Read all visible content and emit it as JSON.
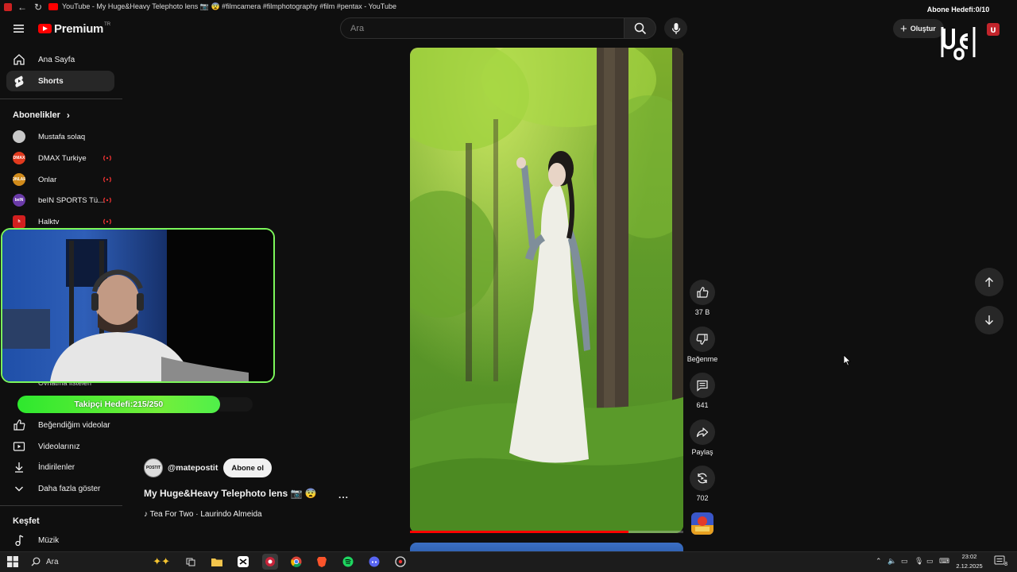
{
  "window": {
    "title": "YouTube - My Huge&Heavy Telephoto lens 📷 😨 #filmcamera #filmphotography #film #pentax - YouTube"
  },
  "header": {
    "brand": "Premium",
    "brand_sup": "TR",
    "search_placeholder": "Ara",
    "create_label": "Oluştur"
  },
  "overlay": {
    "subscriber_goal": "Abone Hedefi:0/10",
    "follower_goal": "Takipçi Hedefi:215/250",
    "follower_progress": 0.86,
    "channel_logo": "UGO"
  },
  "sidebar": {
    "nav": [
      {
        "label": "Ana Sayfa",
        "icon": "home-icon"
      },
      {
        "label": "Shorts",
        "icon": "shorts-icon"
      }
    ],
    "subscriptions_label": "Abonelikler",
    "subscriptions": [
      {
        "label": "Mustafa solaq",
        "avatar": "",
        "live": false,
        "color": "#c8c8c8"
      },
      {
        "label": "DMAX Turkiye",
        "avatar": "DMAX",
        "live": true,
        "color": "#e23a1e"
      },
      {
        "label": "Onlar",
        "avatar": "ONLAR",
        "live": true,
        "color": "#d08a1a"
      },
      {
        "label": "beIN SPORTS Tü...",
        "avatar": "beIN",
        "live": true,
        "color": "#6a3aa8"
      },
      {
        "label": "Halktv",
        "avatar": "h",
        "live": true,
        "color": "#d21f1f"
      }
    ],
    "hidden_item": "Oynatma listeleri",
    "you_items": [
      {
        "label": "Beğendiğim videolar",
        "icon": "like-icon"
      },
      {
        "label": "Videolarınız",
        "icon": "video-icon"
      },
      {
        "label": "İndirilenler",
        "icon": "download-icon"
      },
      {
        "label": "Daha fazla göster",
        "icon": "chevron-down-icon"
      }
    ],
    "explore_label": "Keşfet",
    "explore_items": [
      {
        "label": "Müzik",
        "icon": "music-icon"
      }
    ]
  },
  "short": {
    "channel_handle": "@matepostit",
    "channel_avatar_text": "POSTIT",
    "subscribe_label": "Abone ol",
    "title": "My Huge&Heavy Telephoto lens 📷 😨",
    "more_label": "...",
    "music": "♪ Tea For Two · Laurindo Almeida",
    "progress": 0.8
  },
  "actions": {
    "likes": "37 B",
    "dislike_label": "Beğenme",
    "comments": "641",
    "share_label": "Paylaş",
    "remix": "702"
  },
  "taskbar": {
    "search_placeholder": "Ara",
    "time": "23:02",
    "date": "2.12.2025",
    "notification_count": "8"
  }
}
